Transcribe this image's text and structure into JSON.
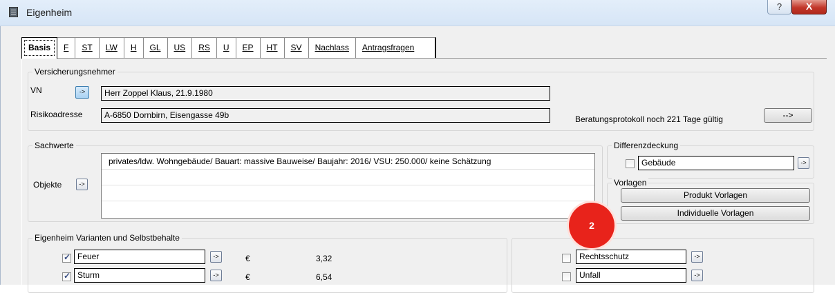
{
  "window": {
    "title": "Eigenheim",
    "help_label": "?",
    "close_label": "X"
  },
  "tabs": [
    "Basis",
    "F",
    "ST",
    "LW",
    "H",
    "GL",
    "US",
    "RS",
    "U",
    "EP",
    "HT",
    "SV",
    "Nachlass",
    "Antragsfragen"
  ],
  "versicherungsnehmer": {
    "title": "Versicherungsnehmer",
    "vn_label": "VN",
    "vn_value": "Herr Zoppel Klaus, 21.9.1980",
    "risiko_label": "Risikoadresse",
    "risiko_value": "A-6850 Dornbirn, Eisengasse 49b",
    "beratung_text": "Beratungsprotokoll noch 221 Tage gültig",
    "beratung_btn": "-->"
  },
  "sachwerte": {
    "title": "Sachwerte",
    "objekte_label": "Objekte",
    "objects": [
      "privates/ldw. Wohngebäude/ Bauart: massive Bauweise/ Baujahr: 2016/ VSU: 250.000/ keine Schätzung",
      "",
      "",
      ""
    ]
  },
  "differenzdeckung": {
    "title": "Differenzdeckung",
    "value": "Gebäude",
    "checked": false
  },
  "vorlagen": {
    "title": "Vorlagen",
    "produkt_btn": "Produkt Vorlagen",
    "individuell_btn": "Individuelle Vorlagen"
  },
  "varianten": {
    "title": "Eigenheim Varianten und Selbstbehalte",
    "rows": [
      {
        "label": "Feuer",
        "checked": true,
        "currency": "€",
        "amount": "3,32"
      },
      {
        "label": "Sturm",
        "checked": true,
        "currency": "€",
        "amount": "6,54"
      }
    ]
  },
  "zusatz": {
    "rows": [
      {
        "label": "Rechtsschutz",
        "checked": false
      },
      {
        "label": "Unfall",
        "checked": false
      }
    ]
  },
  "small_button_label": "->",
  "annotation_badge": "2"
}
